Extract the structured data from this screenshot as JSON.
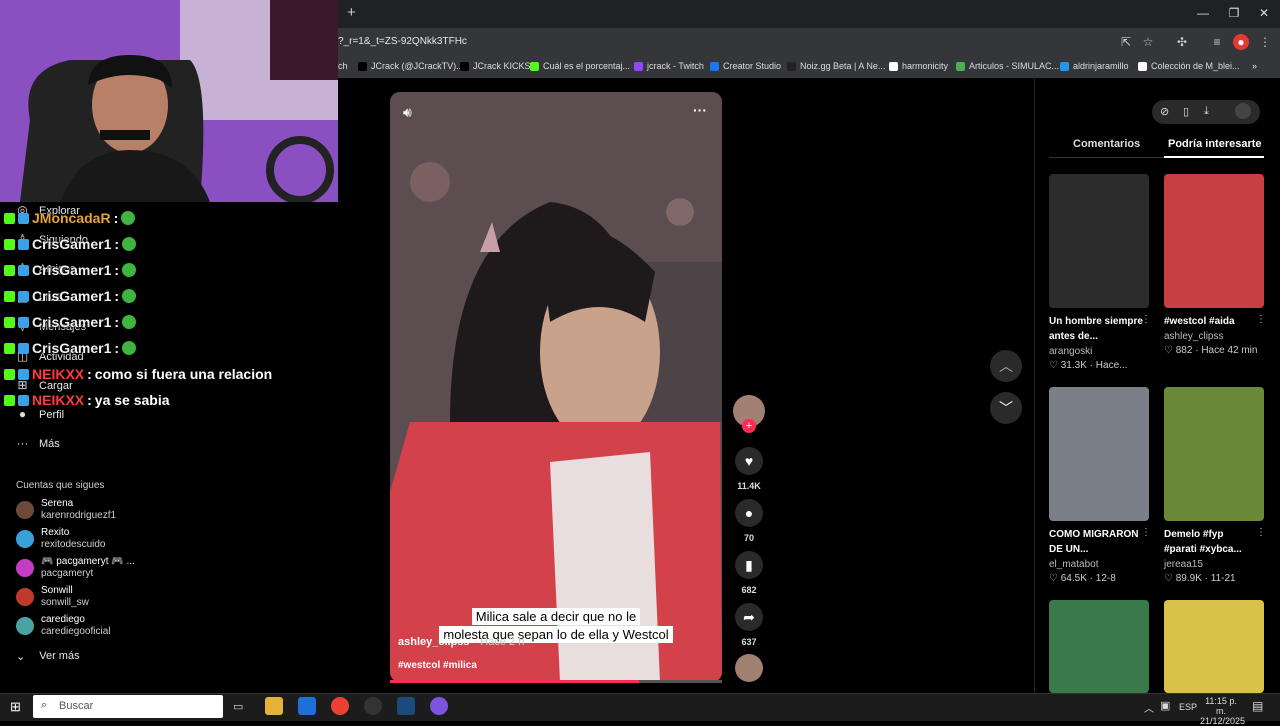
{
  "browser": {
    "new_tab": "+",
    "url": "?_r=1&_t=ZS-92QNkk3TFHc",
    "bookmarks": [
      {
        "label": "ch",
        "color": "#000000"
      },
      {
        "label": "JCrack (@JCrackTV)...",
        "color": "#000000"
      },
      {
        "label": "JCrack KICKS",
        "color": "#000000"
      },
      {
        "label": "Cuál es el porcentaj...",
        "color": "#53fc18"
      },
      {
        "label": "jcrack - Twitch",
        "color": "#9146ff"
      },
      {
        "label": "Creator Studio",
        "color": "#1877f2"
      },
      {
        "label": "Noiz.gg Beta | A Ne...",
        "color": "#222222"
      },
      {
        "label": "harmonicity",
        "color": "#ffffff"
      },
      {
        "label": "Articulos - SIMULAC...",
        "color": "#4caf50"
      },
      {
        "label": "aldrinjaramillo",
        "color": "#2196f3"
      },
      {
        "label": "Colección de M_blei...",
        "color": "#ffffff"
      }
    ],
    "more": "»"
  },
  "sidebar": {
    "items": [
      {
        "label": "Explorar",
        "icon": "compass-icon",
        "glyph": "◎"
      },
      {
        "label": "Siguiendo",
        "icon": "user-icon",
        "glyph": "♙"
      },
      {
        "label": "Amigos",
        "icon": "friends-icon",
        "glyph": "♙"
      },
      {
        "label": "LIVE",
        "icon": "live-icon",
        "glyph": "▣"
      },
      {
        "label": "Mensajes",
        "icon": "messages-icon",
        "glyph": "▽"
      },
      {
        "label": "Actividad",
        "icon": "activity-icon",
        "glyph": "◫"
      },
      {
        "label": "Cargar",
        "icon": "upload-icon",
        "glyph": "⊞"
      },
      {
        "label": "Perfil",
        "icon": "profile-icon",
        "glyph": "●"
      },
      {
        "label": "Más",
        "icon": "more-icon",
        "glyph": "···"
      }
    ],
    "following_title": "Cuentas que sigues",
    "accounts": [
      {
        "name": "Serena",
        "handle": "karenrodriguezf1",
        "color": "#6b4a3a"
      },
      {
        "name": "Rexito",
        "handle": "rexitodescuido",
        "color": "#3aa0d8"
      },
      {
        "name": "🎮 pacgameryt 🎮 ...",
        "handle": "pacgameryt",
        "color": "#c43bc4"
      },
      {
        "name": "Sonwill",
        "handle": "sonwill_sw",
        "color": "#c0392b"
      },
      {
        "name": "carediego",
        "handle": "carediegooficial",
        "color": "#4aa3a0"
      }
    ],
    "see_more": "Ver más"
  },
  "chat": [
    {
      "user": "JMoncadaR",
      "user_color": "#e6a23c",
      "message": ""
    },
    {
      "user": "CrisGamer1",
      "user_color": "#f0f0f0",
      "message": ""
    },
    {
      "user": "CrisGamer1",
      "user_color": "#f0f0f0",
      "message": ""
    },
    {
      "user": "CrisGamer1",
      "user_color": "#f0f0f0",
      "message": ""
    },
    {
      "user": "CrisGamer1",
      "user_color": "#f0f0f0",
      "message": ""
    },
    {
      "user": "CrisGamer1",
      "user_color": "#f0f0f0",
      "message": ""
    },
    {
      "user": "NEIKXX",
      "user_color": "#ff3b3b",
      "message": "como si fuera una relacion"
    },
    {
      "user": "NEIKXX",
      "user_color": "#ff3b3b",
      "message": "ya se sabia"
    }
  ],
  "video": {
    "author": "ashley_clipss",
    "time": "· Hace 2 h",
    "tags": "#westcol #milica",
    "subtitle_line1": "Milica sale a decir que no le",
    "subtitle_line2": "molesta que sepan lo de ella y Westcol",
    "progress": 0.75,
    "likes": "11.4K",
    "comments": "70",
    "saves": "682",
    "shares": "637"
  },
  "right_panel": {
    "tabs": [
      "Comentarios",
      "Podría interesarte"
    ],
    "cards": [
      {
        "title": "Un hombre siempre antes de...",
        "author": "arangoski",
        "likes": "31.3K",
        "time": "Hace...",
        "color": "#2c2c2c"
      },
      {
        "title": "#westcol #aida",
        "author": "ashley_clipss",
        "likes": "882",
        "time": "Hace 42 min",
        "color": "#c83f43"
      },
      {
        "title": "COMO MIGRARON DE UN...",
        "author": "el_matabot",
        "likes": "64.5K",
        "time": "12-8",
        "color": "#7b8088"
      },
      {
        "title": "Demelo #fyp #parati #xybca...",
        "author": "jereaa15",
        "likes": "89.9K",
        "time": "11-21",
        "color": "#6a8a3a"
      },
      {
        "title": "",
        "author": "",
        "likes": "",
        "time": "",
        "color": "#3a7a4a"
      },
      {
        "title": "",
        "author": "",
        "likes": "",
        "time": "",
        "color": "#d8c24a"
      }
    ]
  },
  "taskbar": {
    "search_placeholder": "Buscar",
    "lang": "ESP",
    "time": "11:15 p. m.",
    "date": "21/12/2025"
  }
}
